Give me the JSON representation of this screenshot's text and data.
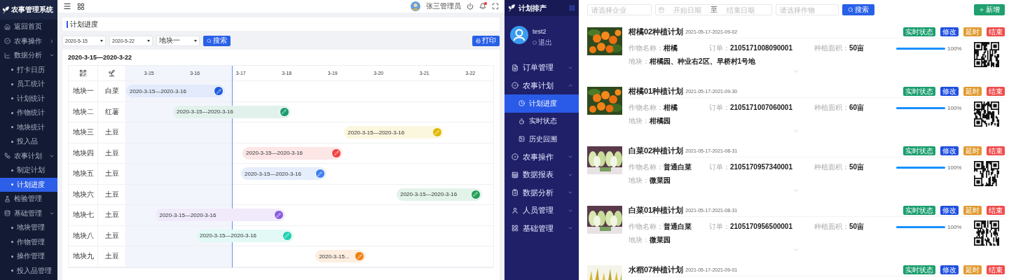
{
  "left_app": {
    "sidebar": {
      "title": "农事管理系统",
      "items": [
        {
          "label": "返回首页",
          "selected": false
        },
        {
          "label": "农事操作",
          "selected": false,
          "expanded": false
        },
        {
          "label": "数据分析",
          "selected": false,
          "expanded": true,
          "children": [
            {
              "label": "打卡日历",
              "selected": false
            },
            {
              "label": "员工统计",
              "selected": false
            },
            {
              "label": "计划统计",
              "selected": false
            },
            {
              "label": "作物统计",
              "selected": false
            },
            {
              "label": "地块统计",
              "selected": false
            },
            {
              "label": "投入品",
              "selected": false
            }
          ]
        },
        {
          "label": "农事计划",
          "selected": false,
          "expanded": true,
          "children": [
            {
              "label": "制定计划",
              "selected": false
            },
            {
              "label": "计划进度",
              "selected": true
            }
          ]
        },
        {
          "label": "检验管理",
          "selected": false
        },
        {
          "label": "基础管理",
          "selected": false,
          "expanded": true,
          "children": [
            {
              "label": "地块管理",
              "selected": false
            },
            {
              "label": "作物管理",
              "selected": false
            },
            {
              "label": "操作管理",
              "selected": false
            },
            {
              "label": "投入品管理",
              "selected": false
            }
          ]
        }
      ]
    },
    "topbar": {
      "user": "张三管理员",
      "unread": true
    },
    "page_title": "计划进度",
    "filters": {
      "start_date": "2020-5-15",
      "end_date": "2020-5-22",
      "plot": "地块一",
      "search_button": "搜索",
      "print_button": "打印"
    },
    "gantt": {
      "range_title": "2020-3-15—2020-3-22",
      "days": [
        "3-15",
        "3-16",
        "3-17",
        "3-18",
        "3-19",
        "3-20",
        "3-21",
        "3-22"
      ],
      "rows": [
        {
          "plot": "地块一",
          "crop": "白菜",
          "bar_label": "2020-3-15—2020-3-16",
          "color": "#1e5ae0"
        },
        {
          "plot": "地块二",
          "crop": "红薯",
          "bar_label": "2020-3-15—2020-3-16",
          "color": "#1a9a6a"
        },
        {
          "plot": "地块三",
          "crop": "土豆",
          "bar_label": "2020-3-15—2020-3-16",
          "color": "#e0b800"
        },
        {
          "plot": "地块四",
          "crop": "土豆",
          "bar_label": "2020-3-15—2020-3-16",
          "color": "#f04040"
        },
        {
          "plot": "地块五",
          "crop": "土豆",
          "bar_label": "2020-3-15—2020-3-16",
          "color": "#3b7ef0"
        },
        {
          "plot": "地块六",
          "crop": "土豆",
          "bar_label": "2020-3-15—2020-3-16",
          "color": "#22a05a"
        },
        {
          "plot": "地块七",
          "crop": "土豆",
          "bar_label": "2020-3-15—2020-3-16",
          "color": "#8a5ce0"
        },
        {
          "plot": "地块八",
          "crop": "土豆",
          "bar_label": "2020-3-15—2020-3-16",
          "color": "#1ed0b0"
        },
        {
          "plot": "地块九",
          "crop": "土豆",
          "bar_label": "2020-3-15...",
          "color": "#f08010"
        }
      ]
    }
  },
  "right_app": {
    "sidebar": {
      "title": "计划排产",
      "user": "test2",
      "logout": "退出",
      "items": [
        {
          "label": "订单管理",
          "selected": false,
          "expanded": false
        },
        {
          "label": "农事计划",
          "selected": false,
          "expanded": true,
          "children": [
            {
              "label": "计划进度",
              "selected": true
            },
            {
              "label": "实时状态",
              "selected": false
            },
            {
              "label": "历史回溯",
              "selected": false
            }
          ]
        },
        {
          "label": "农事操作",
          "selected": false,
          "expanded": false
        },
        {
          "label": "数据报表",
          "selected": false,
          "expanded": false
        },
        {
          "label": "数据分析",
          "selected": false,
          "expanded": false
        },
        {
          "label": "人员管理",
          "selected": false,
          "expanded": false
        },
        {
          "label": "基础管理",
          "selected": false,
          "expanded": false
        }
      ]
    },
    "filters": {
      "company_placeholder": "请选择企业",
      "start_placeholder": "开始日期",
      "range_separator": "至",
      "end_placeholder": "结束日期",
      "crop_placeholder": "请选择作物",
      "search_button": "搜索",
      "add_button": "新增"
    },
    "plans": [
      {
        "title": "柑橘02种植计划",
        "dates": "2021-05-17-2021-09-02",
        "tags": [
          {
            "label": "实时状态",
            "color": "#1a9e6e"
          },
          {
            "label": "修改",
            "color": "#1f4fe0"
          },
          {
            "label": "延时",
            "color": "#e09a30"
          },
          {
            "label": "结束",
            "color": "#f04b4b"
          }
        ],
        "crop_label": "作物名称：",
        "crop": "柑橘",
        "order_label": "订单：",
        "order": "2105171008090001",
        "area_label": "种植面积：",
        "area": "50亩",
        "level": 1,
        "progress": "100%",
        "plot_label": "地块：",
        "plot": "柑橘园、种业右2区、早桥村1号地"
      },
      {
        "title": "柑橘01种植计划",
        "dates": "2021-05-17-2021-09-30",
        "tags": [
          {
            "label": "实时状态",
            "color": "#1a9e6e"
          },
          {
            "label": "修改",
            "color": "#1f4fe0"
          },
          {
            "label": "延时",
            "color": "#e09a30"
          },
          {
            "label": "结束",
            "color": "#f04b4b"
          }
        ],
        "crop_label": "作物名称：",
        "crop": "柑橘",
        "order_label": "订单：",
        "order": "2105171007060001",
        "area_label": "种植面积：",
        "area": "60亩",
        "level": 1,
        "progress": "100%",
        "plot_label": "地块：",
        "plot": "柑橘园"
      },
      {
        "title": "白菜02种植计划",
        "dates": "2021-05-17-2021-08-31",
        "tags": [
          {
            "label": "实时状态",
            "color": "#1a9e6e"
          },
          {
            "label": "修改",
            "color": "#1f4fe0"
          },
          {
            "label": "延时",
            "color": "#e09a30"
          },
          {
            "label": "结束",
            "color": "#f04b4b"
          }
        ],
        "crop_label": "作物名称：",
        "crop": "普通白菜",
        "order_label": "订单：",
        "order": "2105170957340001",
        "area_label": "种植面积：",
        "area": "50亩",
        "level": 1,
        "progress": "100%",
        "plot_label": "地块：",
        "plot": "微菜园"
      },
      {
        "title": "白菜01种植计划",
        "dates": "2021-05-17-2021-08-31",
        "tags": [
          {
            "label": "实时状态",
            "color": "#1a9e6e"
          },
          {
            "label": "修改",
            "color": "#1f4fe0"
          },
          {
            "label": "延时",
            "color": "#e09a30"
          },
          {
            "label": "结束",
            "color": "#f04b4b"
          }
        ],
        "crop_label": "作物名称：",
        "crop": "普通白菜",
        "order_label": "订单：",
        "order": "2105170956500001",
        "area_label": "种植面积：",
        "area": "50亩",
        "level": 1,
        "progress": "100%",
        "plot_label": "地块：",
        "plot": "微菜园"
      },
      {
        "title": "水稻07种植计划",
        "dates": "2021-05-17-2021-09-01",
        "tags": [
          {
            "label": "实时状态",
            "color": "#1a9e6e"
          },
          {
            "label": "修改",
            "color": "#1f4fe0"
          },
          {
            "label": "延时",
            "color": "#e09a30"
          },
          {
            "label": "结束",
            "color": "#f04b4b"
          }
        ]
      }
    ]
  }
}
